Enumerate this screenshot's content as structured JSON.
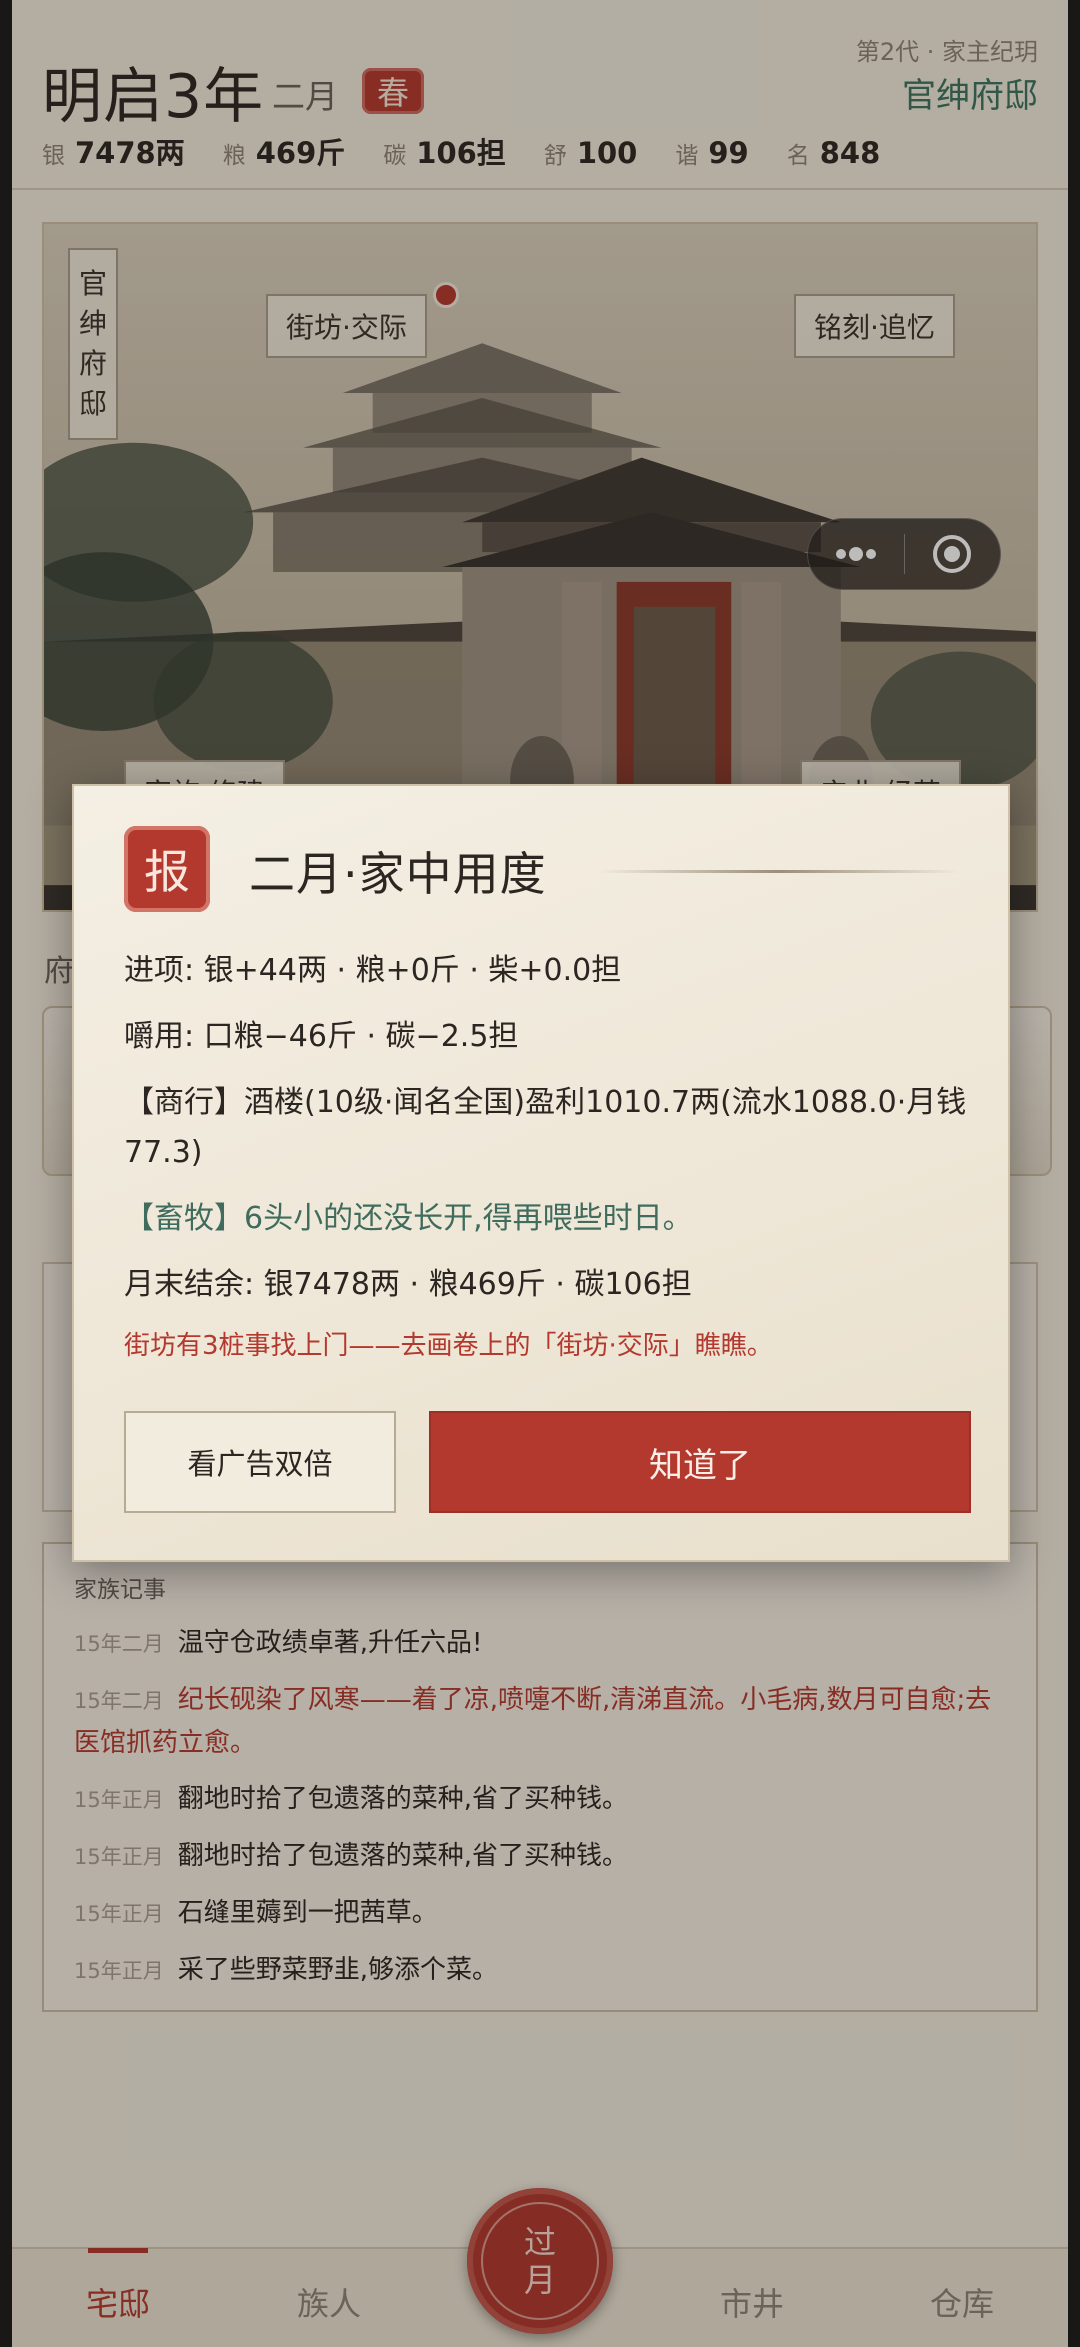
{
  "header": {
    "year": "明启3年",
    "month": "二月",
    "season": "春",
    "generation": "第2代 · 家主纪玥",
    "house": "官绅府邸",
    "resources": [
      {
        "k": "银",
        "v": "7478两"
      },
      {
        "k": "粮",
        "v": "469斤"
      },
      {
        "k": "碳",
        "v": "106担"
      },
      {
        "k": "舒",
        "v": "100"
      },
      {
        "k": "谐",
        "v": "99"
      },
      {
        "k": "名",
        "v": "848"
      }
    ]
  },
  "painting": {
    "title_vertical": [
      "官",
      "绅",
      "府",
      "邸"
    ],
    "labels": {
      "street": "街坊·交际",
      "engrave": "铭刻·追忆",
      "build": "家族·修建",
      "industry": "产业·经营"
    }
  },
  "background": {
    "section_title": "府"
  },
  "chronicle": {
    "title": "家族记事",
    "items": [
      {
        "date": "15年二月",
        "text": "温守仓政绩卓著,升任六品!",
        "alert": false
      },
      {
        "date": "15年二月",
        "text": "纪长砚染了风寒——着了凉,喷嚏不断,清涕直流。小毛病,数月可自愈;去医馆抓药立愈。",
        "alert": true
      },
      {
        "date": "15年正月",
        "text": "翻地时拾了包遗落的菜种,省了买种钱。",
        "alert": false
      },
      {
        "date": "15年正月",
        "text": "翻地时拾了包遗落的菜种,省了买种钱。",
        "alert": false
      },
      {
        "date": "15年正月",
        "text": "石缝里薅到一把茜草。",
        "alert": false
      },
      {
        "date": "15年正月",
        "text": "采了些野菜野韭,够添个菜。",
        "alert": false
      }
    ]
  },
  "modal": {
    "seal": "报",
    "title": "二月·家中用度",
    "income": "进项: 银+44两 · 粮+0斤 · 柴+0.0担",
    "expense": "嚼用: 口粮−46斤 · 碳−2.5担",
    "trade": "【商行】酒楼(10级·闻名全国)盈利1010.7两(流水1088.0·月钱77.3)",
    "herd": "【畜牧】6头小的还没长开,得再喂些时日。",
    "balance": "月末结余: 银7478两 · 粮469斤 · 碳106担",
    "note": "街坊有3桩事找上门——去画卷上的「街坊·交际」瞧瞧。",
    "btn_ad": "看广告双倍",
    "btn_ok": "知道了"
  },
  "tabbar": {
    "tabs": [
      "宅邸",
      "族人",
      "市井",
      "仓库"
    ],
    "fab": [
      "过",
      "月"
    ]
  },
  "colors": {
    "accent_red": "#b3392f",
    "accent_green": "#3c7460",
    "paper": "#f1ebdd"
  }
}
